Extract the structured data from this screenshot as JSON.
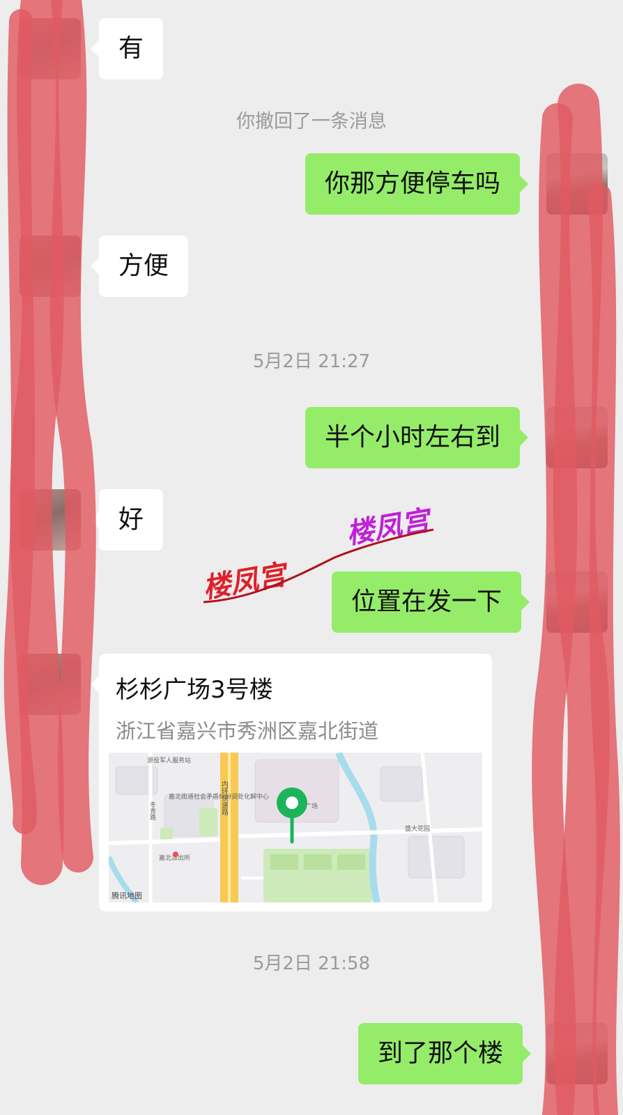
{
  "messages": {
    "m1": "有",
    "recall": "你撤回了一条消息",
    "m2": "你那方便停车吗",
    "m3": "方便",
    "time1": "5月2日 21:27",
    "m4": "半个小时左右到",
    "m5": "好",
    "m6": "位置在发一下",
    "location": {
      "name": "杉杉广场3号楼",
      "address": "浙江省嘉兴市秀洲区嘉北街道",
      "map_attribution": "腾讯地图",
      "map_labels": {
        "road": "内环快速路",
        "police": "嘉北派出所",
        "center": "嘉北街道社会矛盾纠纷调处化解中心",
        "service": "退役军人服务站",
        "garden": "盛大花园",
        "plaza": "广场",
        "street": "冬青路"
      }
    },
    "time2": "5月2日 21:58",
    "m7": "到了那个楼"
  },
  "watermark": {
    "text1": "楼凤宫",
    "text2": "楼凤宫",
    "color1": "#e0202a",
    "color2": "#c020d8"
  },
  "colors": {
    "background": "#ededed",
    "outgoing_bubble": "#95ec69",
    "incoming_bubble": "#ffffff",
    "system_text": "#9a9a9a",
    "map_pin": "#1bb45a",
    "scribble": "#e05a62"
  }
}
